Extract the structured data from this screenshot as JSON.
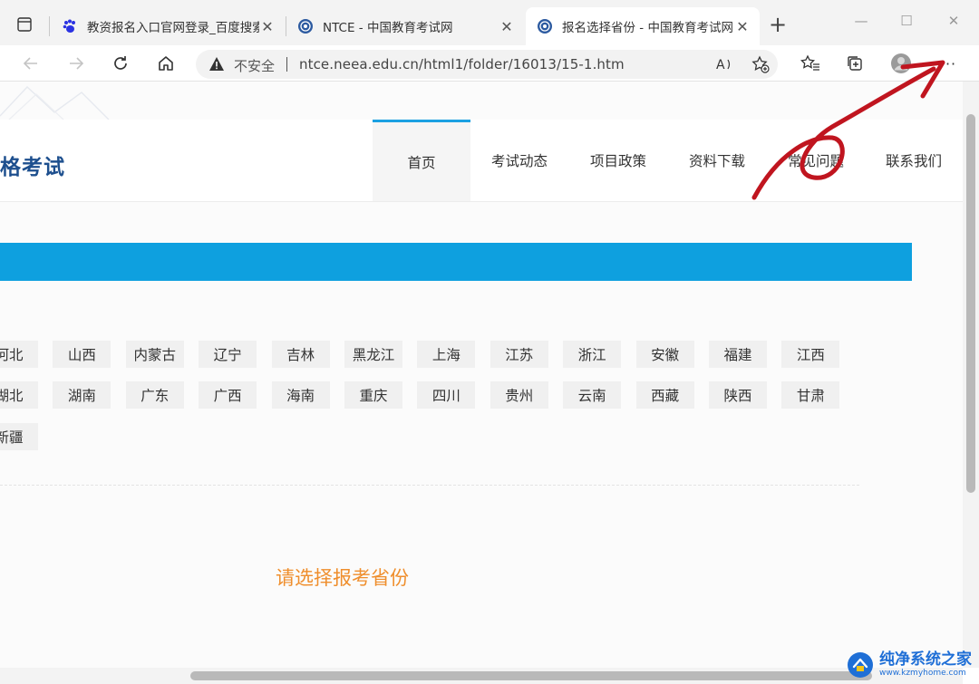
{
  "browser": {
    "tabs": [
      {
        "title": "教资报名入口官网登录_百度搜索",
        "favicon": "baidu-paw-icon",
        "close": "✕"
      },
      {
        "title": "NTCE - 中国教育考试网",
        "favicon": "neea-seal-icon",
        "close": "✕"
      },
      {
        "title": "报名选择省份 - 中国教育考试网",
        "favicon": "neea-seal-icon",
        "close": "✕",
        "active": true
      }
    ],
    "new_tab": "+",
    "address": {
      "security_label": "不安全",
      "url": "ntce.neea.edu.cn/html1/folder/16013/15-1.htm"
    },
    "window_controls": [
      "—",
      "☐",
      "✕"
    ],
    "menu_label": "···"
  },
  "page": {
    "site_title": "格考试",
    "nav": [
      "首页",
      "考试动态",
      "项目政策",
      "资料下载",
      "常见问题",
      "联系我们"
    ],
    "provinces": [
      [
        "河北",
        "山西",
        "内蒙古",
        "辽宁",
        "吉林",
        "黑龙江",
        "上海",
        "江苏",
        "浙江",
        "安徽",
        "福建",
        "江西"
      ],
      [
        "湖北",
        "湖南",
        "广东",
        "广西",
        "海南",
        "重庆",
        "四川",
        "贵州",
        "云南",
        "西藏",
        "陕西",
        "甘肃"
      ],
      [
        "新疆"
      ]
    ],
    "select_prompt": "请选择报考省份"
  },
  "watermark": {
    "name": "纯净系统之家",
    "url": "www.kzmyhome.com"
  },
  "colors": {
    "nav_accent": "#1ba0e2",
    "banner": "#0ea0df",
    "prompt": "#ef8e2c",
    "title": "#1d4f8e",
    "annotation_arrow": "#c0151f"
  }
}
